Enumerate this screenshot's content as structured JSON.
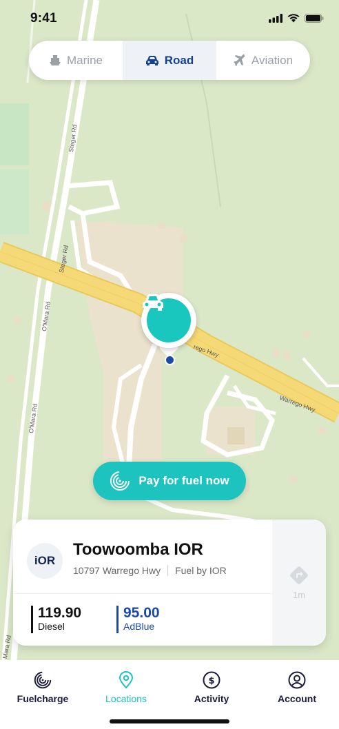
{
  "status_bar": {
    "time": "9:41"
  },
  "mode_switch": {
    "options": [
      {
        "label": "Marine",
        "icon": "ship-icon",
        "active": false
      },
      {
        "label": "Road",
        "icon": "car-icon",
        "active": true
      },
      {
        "label": "Aviation",
        "icon": "plane-icon",
        "active": false
      }
    ]
  },
  "map": {
    "road_labels": {
      "steger_top": "Steger Rd",
      "steger_mid": "Steger Rd",
      "omara_top": "O'Mara Rd",
      "omara_mid": "O'Mara Rd",
      "omara_bottom": "Mara Rd",
      "warrego_near": "rego Hwy",
      "warrego_far": "Warrego Hwy"
    },
    "selected_station_icon": "car-icon",
    "colors": {
      "map_bg": "#dbe8c8",
      "highway": "#f3d36b",
      "accent": "#1cc3bf"
    }
  },
  "pay_button": {
    "label": "Pay for fuel now",
    "icon": "fuelcharge-icon"
  },
  "station": {
    "logo_text": "iOR",
    "name": "Toowoomba IOR",
    "address": "10797 Warrego Hwy",
    "provider": "Fuel by IOR",
    "prices": [
      {
        "value": "119.90",
        "label": "Diesel"
      },
      {
        "value": "95.00",
        "label": "AdBlue"
      }
    ],
    "navigate": {
      "icon": "directions-icon",
      "distance": "1m"
    }
  },
  "tab_bar": {
    "tabs": [
      {
        "label": "Fuelcharge",
        "icon": "fuelcharge-icon",
        "active": false
      },
      {
        "label": "Locations",
        "icon": "location-pin-icon",
        "active": true
      },
      {
        "label": "Activity",
        "icon": "dollar-circle-icon",
        "active": false
      },
      {
        "label": "Account",
        "icon": "user-circle-icon",
        "active": false
      }
    ]
  }
}
